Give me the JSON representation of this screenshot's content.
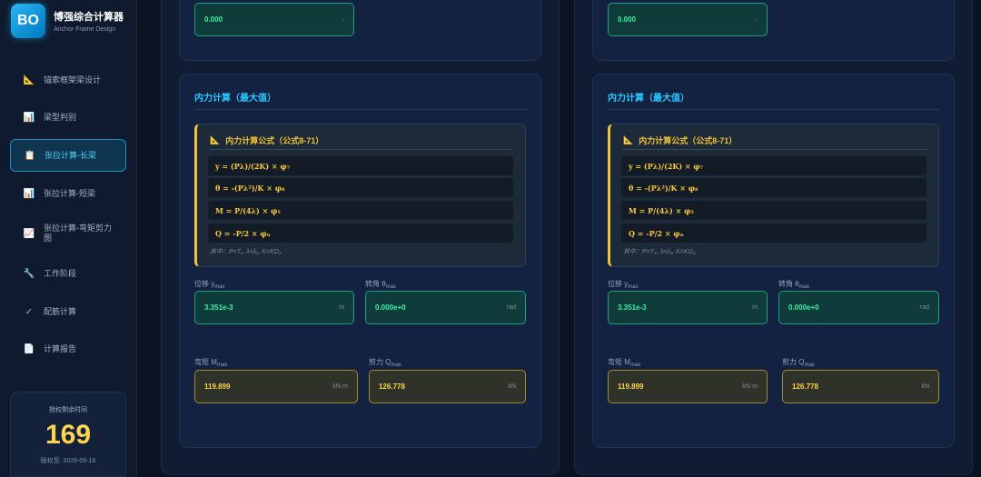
{
  "brand": {
    "logo": "BO",
    "title": "博强综合计算器",
    "subtitle": "Anchor Frame Design"
  },
  "nav": [
    {
      "label": "锚索框架梁设计",
      "icon": "📐",
      "active": false
    },
    {
      "label": "梁型判别",
      "icon": "📊",
      "active": false
    },
    {
      "label": "张拉计算-长梁",
      "icon": "📋",
      "active": true
    },
    {
      "label": "张拉计算-短梁",
      "icon": "📊",
      "active": false
    },
    {
      "label": "张拉计算-弯矩剪力图",
      "icon": "📈",
      "active": false
    },
    {
      "label": "工作阶段",
      "icon": "🔧",
      "active": false
    },
    {
      "label": "配筋计算",
      "icon": "✓",
      "active": false
    },
    {
      "label": "计算报告",
      "icon": "📄",
      "active": false
    }
  ],
  "license": {
    "title": "授权剩余时间",
    "days": "169",
    "date": "版权至: 2026-06-16"
  },
  "columns": [
    {
      "top_value": "0.000",
      "top_unit": "-",
      "section_title": "内力计算（最大值）",
      "formula_title": "内力计算公式（公式8-71）",
      "formulas": [
        "y = (Pλ)/(2K) × φ₇",
        "θ = -(Pλ²)/K × φ₈",
        "M = P/(4λ) × φ₅",
        "Q = -P/2 × φₙ"
      ],
      "note": "其中：P=T₁, λ=λ₁, K=KΩ₁",
      "fields": {
        "y": {
          "label": "位移 y",
          "sub": "max",
          "value": "3.351e-3",
          "unit": "m"
        },
        "theta": {
          "label": "转角 θ",
          "sub": "max",
          "value": "0.000e+0",
          "unit": "rad"
        },
        "m": {
          "label": "弯矩 M",
          "sub": "max",
          "value": "119.899",
          "unit": "kN·m"
        },
        "q": {
          "label": "剪力 Q",
          "sub": "max",
          "value": "126.778",
          "unit": "kN"
        }
      }
    },
    {
      "top_value": "0.000",
      "top_unit": "-",
      "section_title": "内力计算（最大值）",
      "formula_title": "内力计算公式（公式8-71）",
      "formulas": [
        "y = (Pλ)/(2K) × φ₇",
        "θ = -(Pλ²)/K × φ₈",
        "M = P/(4λ) × φ₅",
        "Q = -P/2 × φₙ"
      ],
      "note": "其中：P=T₂, λ=λ₂, K=KΩ₂",
      "fields": {
        "y": {
          "label": "位移 y",
          "sub": "max",
          "value": "3.351e-3",
          "unit": "m"
        },
        "theta": {
          "label": "转角 θ",
          "sub": "max",
          "value": "0.000e+0",
          "unit": "rad"
        },
        "m": {
          "label": "弯矩 M",
          "sub": "max",
          "value": "119.899",
          "unit": "kN·m"
        },
        "q": {
          "label": "剪力 Q",
          "sub": "max",
          "value": "126.778",
          "unit": "kN"
        }
      }
    }
  ],
  "colors": {
    "accent": "#29c7ff",
    "formula": "#f2c233",
    "value_green": "#3df2a1",
    "value_yellow": "#ffd54f"
  }
}
